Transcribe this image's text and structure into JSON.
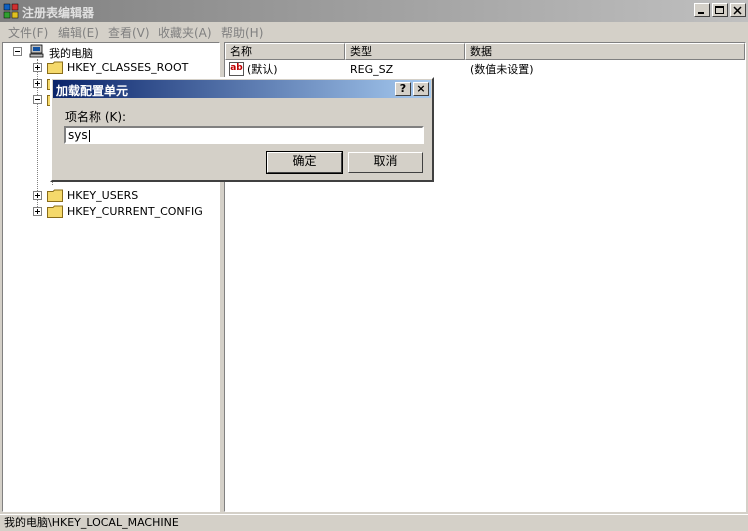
{
  "window": {
    "title": "注册表编辑器"
  },
  "menu": [
    "文件(F)",
    "编辑(E)",
    "查看(V)",
    "收藏夹(A)",
    "帮助(H)"
  ],
  "tree": {
    "root": "我的电脑",
    "hkcr": "HKEY_CLASSES_ROOT",
    "users": "HKEY_USERS",
    "current_config": "HKEY_CURRENT_CONFIG"
  },
  "list": {
    "headers": {
      "name": "名称",
      "type": "类型",
      "data": "数据"
    },
    "rows": [
      {
        "icon": "ab",
        "name": "(默认)",
        "type": "REG_SZ",
        "data": "(数值未设置)"
      }
    ]
  },
  "statusbar": "我的电脑\\HKEY_LOCAL_MACHINE",
  "dialog": {
    "title": "加载配置单元",
    "help_btn": "?",
    "close_btn": "×",
    "label": "项名称 (K):",
    "input_value": "sys",
    "ok": "确定",
    "cancel": "取消"
  },
  "colors": {
    "dialog_title_start": "#0a246a",
    "dialog_title_end": "#a6caf0",
    "window_face": "#d4d0c8",
    "folder": "#f5d96b"
  }
}
